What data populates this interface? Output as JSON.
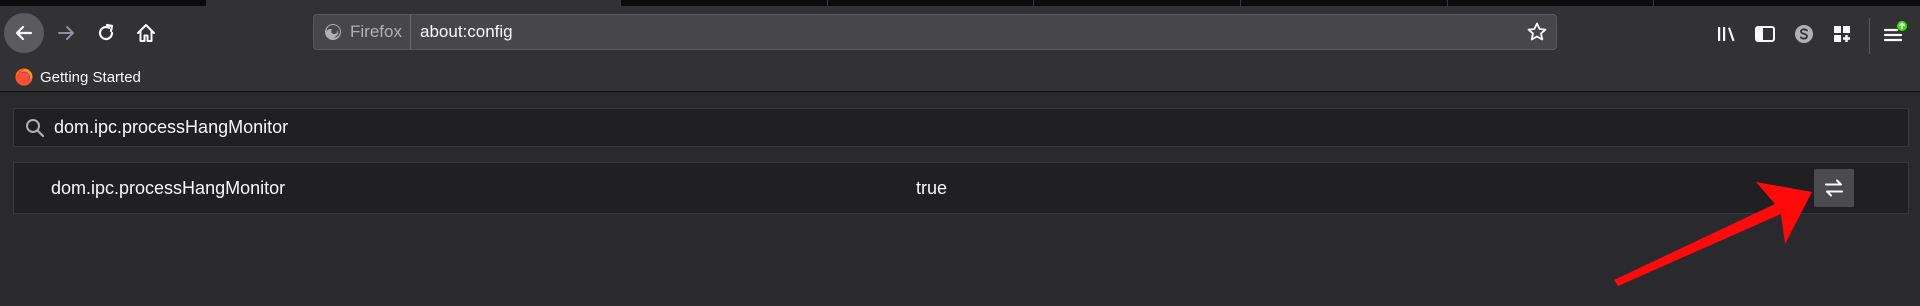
{
  "browser": {
    "identity_label": "Firefox",
    "url": "about:config"
  },
  "bookmarks": {
    "items": [
      {
        "label": "Getting Started"
      }
    ]
  },
  "config": {
    "search_value": "dom.ipc.processHangMonitor",
    "preference": {
      "name": "dom.ipc.processHangMonitor",
      "value": "true"
    }
  },
  "icons": {
    "back": "back-arrow-icon",
    "forward": "forward-arrow-icon",
    "reload": "reload-icon",
    "home": "home-icon",
    "star": "star-icon",
    "library": "library-icon",
    "sidebar": "sidebar-icon",
    "sync": "account-icon",
    "extensions": "extensions-icon",
    "menu": "hamburger-menu-icon",
    "toggle": "toggle-swap-icon"
  },
  "colors": {
    "background": "#2a2a2e",
    "toolbar": "#323234",
    "annotation": "#ff0a0a",
    "update_badge": "#30e60b"
  }
}
